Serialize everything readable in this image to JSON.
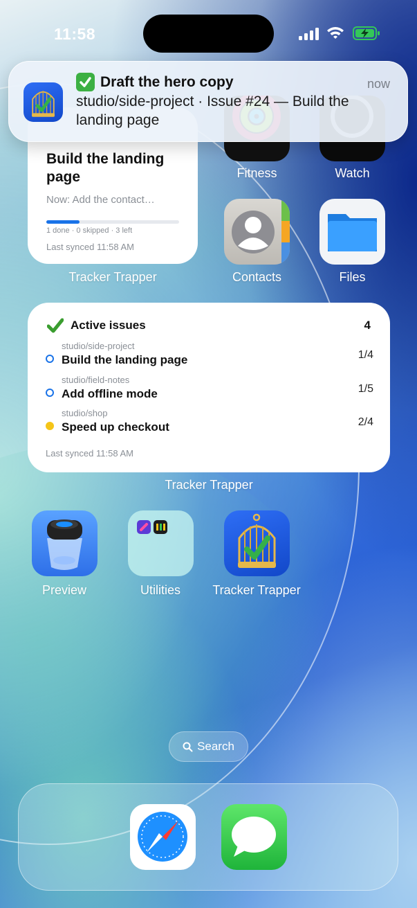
{
  "status": {
    "time": "11:58"
  },
  "notification": {
    "emoji_title": "Draft the hero copy",
    "when": "now",
    "body": "studio/side-project · Issue #24 — Build the landing page"
  },
  "widget_small": {
    "heading": "Build the landing page",
    "now": "Now: Add the contact…",
    "progress": 0.25,
    "stats": "1 done · 0 skipped · 3 left",
    "synced": "Last synced 11:58 AM",
    "caption": "Tracker Trapper"
  },
  "apps_top": [
    {
      "label": "Fitness"
    },
    {
      "label": "Watch"
    },
    {
      "label": "Contacts"
    },
    {
      "label": "Files"
    }
  ],
  "widget_big": {
    "title": "Active issues",
    "count": "4",
    "rows": [
      {
        "repo": "studio/side-project",
        "name": "Build the landing page",
        "progress": "1/4",
        "color": "#1a73e8",
        "filled": false
      },
      {
        "repo": "studio/field-notes",
        "name": "Add offline mode",
        "progress": "1/5",
        "color": "#1a73e8",
        "filled": false
      },
      {
        "repo": "studio/shop",
        "name": "Speed up checkout",
        "progress": "2/4",
        "color": "#f5c518",
        "filled": true
      }
    ],
    "synced": "Last synced 11:58 AM",
    "caption": "Tracker Trapper"
  },
  "apps_row": [
    {
      "label": "Preview"
    },
    {
      "label": "Utilities"
    },
    {
      "label": "Tracker Trapper"
    }
  ],
  "search": {
    "label": "Search"
  },
  "dock": [
    {
      "name": "Safari"
    },
    {
      "name": "Messages"
    }
  ]
}
